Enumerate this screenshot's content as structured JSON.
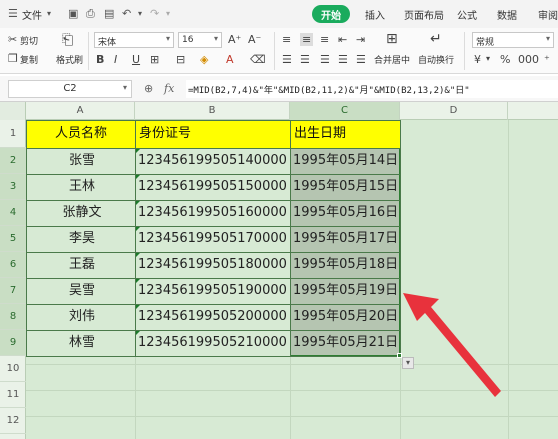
{
  "menu": {
    "file_label": "文件",
    "tabs": [
      "开始",
      "插入",
      "页面布局",
      "公式",
      "数据",
      "审阅"
    ],
    "active_tab": "开始"
  },
  "ribbon": {
    "cut_label": "剪切",
    "copy_label": "复制",
    "format_painter_label": "格式刷",
    "paste_label": "粘贴",
    "font_name": "宋体",
    "font_size": "16",
    "merge_label": "合并居中",
    "wrap_label": "自动换行",
    "number_format": "常规",
    "percent_label": "%",
    "thousands_label": "000"
  },
  "formula_bar": {
    "name_box": "C2",
    "fx_label": "fx",
    "formula": "=MID(B2,7,4)&\"年\"&MID(B2,11,2)&\"月\"&MID(B2,13,2)&\"日\""
  },
  "sheet": {
    "columns": [
      "A",
      "B",
      "C",
      "D"
    ],
    "rows": [
      "1",
      "2",
      "3",
      "4",
      "5",
      "6",
      "7",
      "8",
      "9",
      "10",
      "11",
      "12"
    ],
    "selected_column": "C",
    "headers": [
      "人员名称",
      "身份证号",
      "出生日期"
    ],
    "data": [
      [
        "张雪",
        "123456199505140000",
        "1995年05月14日"
      ],
      [
        "王林",
        "123456199505150000",
        "1995年05月15日"
      ],
      [
        "张静文",
        "123456199505160000",
        "1995年05月16日"
      ],
      [
        "李昊",
        "123456199505170000",
        "1995年05月17日"
      ],
      [
        "王磊",
        "123456199505180000",
        "1995年05月18日"
      ],
      [
        "吴雪",
        "123456199505190000",
        "1995年05月19日"
      ],
      [
        "刘伟",
        "123456199505200000",
        "1995年05月20日"
      ],
      [
        "林雪",
        "123456199505210000",
        "1995年05月21日"
      ]
    ]
  },
  "colors": {
    "header_fill": "#ffff00",
    "selection_fill": "#b5c5b1",
    "arrow_red": "#e8323c",
    "active_tab": "#1aab5d",
    "grid_bg": "#d7ead4"
  },
  "annotation": {
    "icon": "red-pointer-arrow-icon"
  }
}
